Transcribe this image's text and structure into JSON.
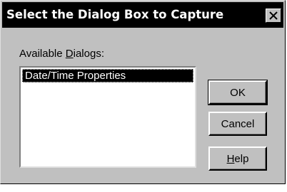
{
  "window": {
    "title": "Select the Dialog Box to Capture",
    "close_icon": "close-icon"
  },
  "main": {
    "list_label_prefix": "Available ",
    "list_label_accel": "D",
    "list_label_suffix": "ialogs:",
    "list_items": [
      {
        "label": "Date/Time Properties",
        "selected": true
      }
    ]
  },
  "buttons": {
    "ok": "OK",
    "cancel": "Cancel",
    "help_accel": "H",
    "help_rest": "elp"
  }
}
